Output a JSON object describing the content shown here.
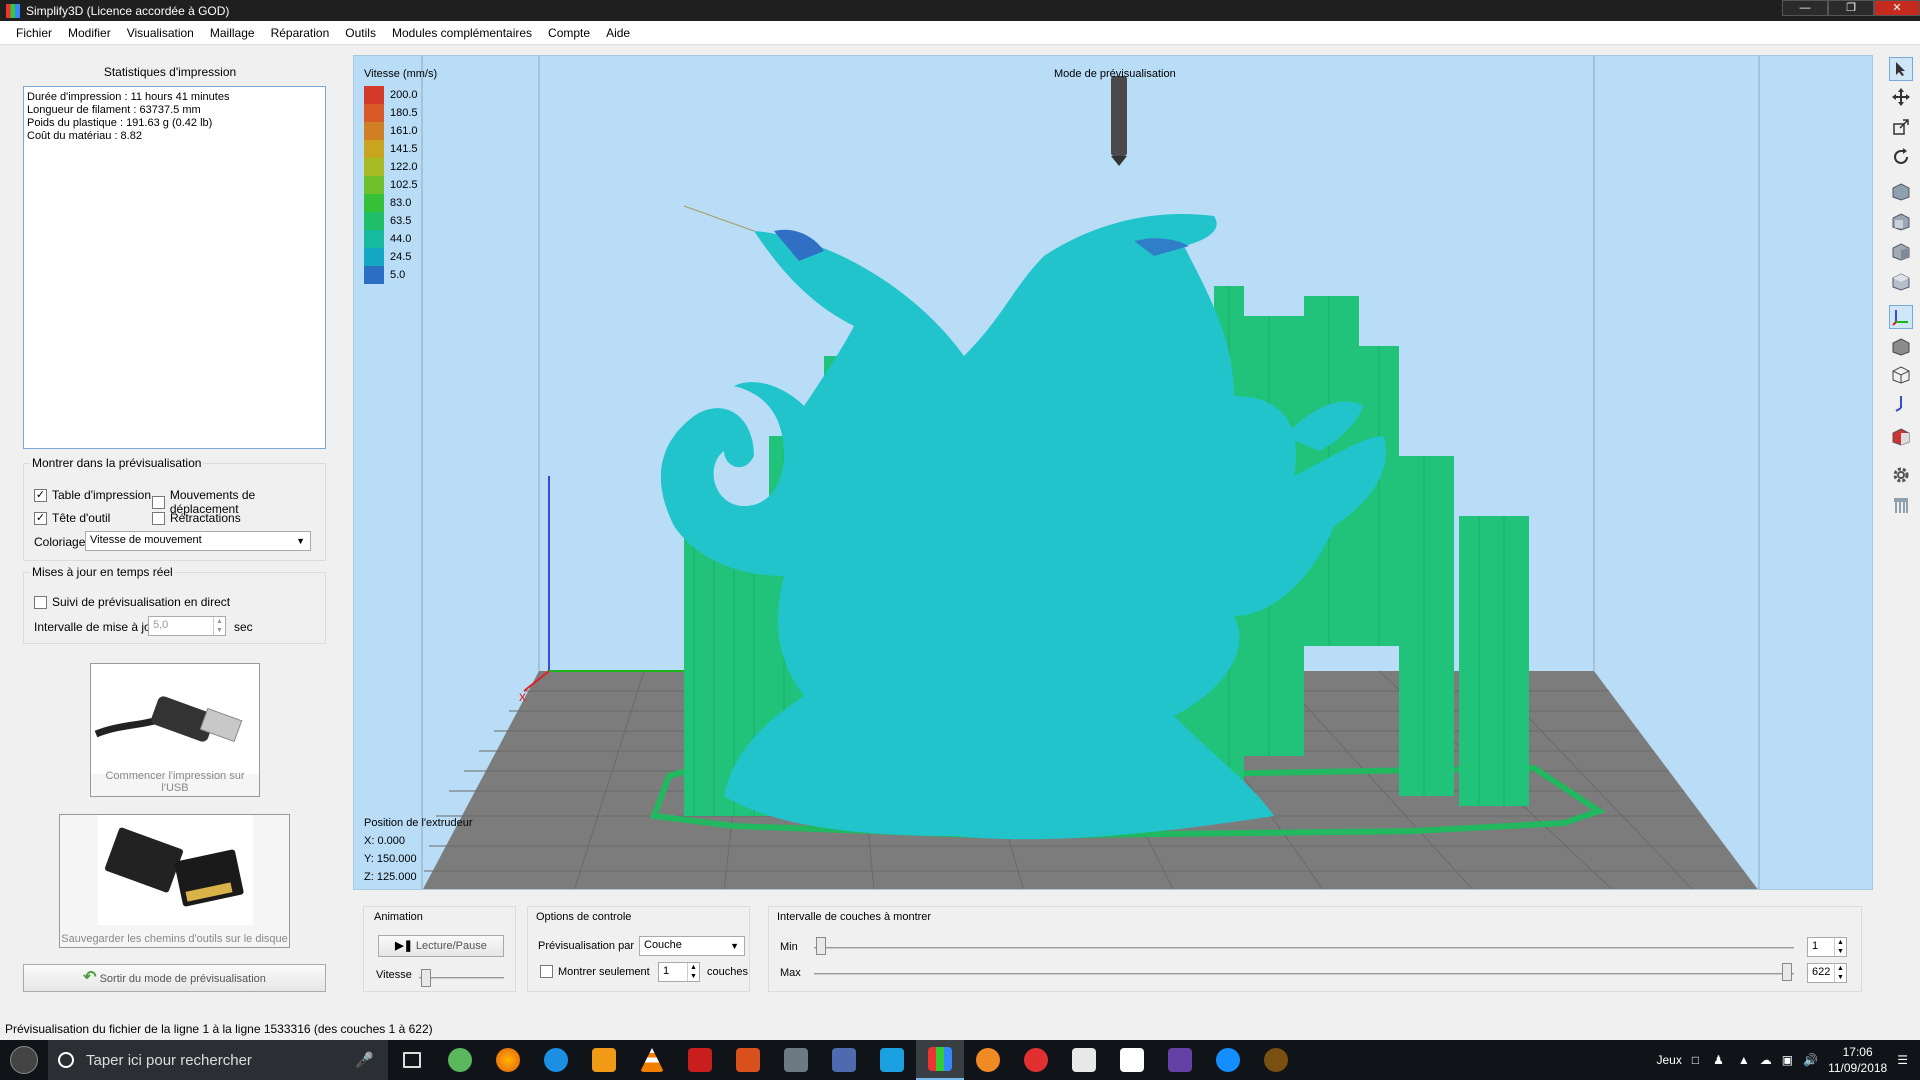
{
  "window": {
    "title": "Simplify3D (Licence accordée à GOD)"
  },
  "menu": [
    "Fichier",
    "Modifier",
    "Visualisation",
    "Maillage",
    "Réparation",
    "Outils",
    "Modules complémentaires",
    "Compte",
    "Aide"
  ],
  "stats": {
    "title": "Statistiques d'impression",
    "lines": [
      "Durée d'impression : 11 hours 41 minutes",
      "Longueur de filament : 63737.5 mm",
      "Poids du plastique : 191.63 g (0.42 lb)",
      "Coût du matériau : 8.82"
    ]
  },
  "preview_show": {
    "title": "Montrer dans la prévisualisation",
    "table": {
      "label": "Table d'impression",
      "checked": true
    },
    "travel": {
      "label": "Mouvements de déplacement",
      "checked": false
    },
    "tool_head": {
      "label": "Tête d'outil",
      "checked": true
    },
    "retractions": {
      "label": "Rétractations",
      "checked": false
    },
    "coloring_label": "Coloriage",
    "coloring_value": "Vitesse de mouvement"
  },
  "realtime": {
    "title": "Mises à jour en temps réel",
    "follow": {
      "label": "Suivi de prévisualisation en direct",
      "checked": false
    },
    "interval_label": "Intervalle de mise à jour",
    "interval_value": "5,0",
    "interval_unit": "sec"
  },
  "usb_button": {
    "label": "Commencer l'impression sur l'USB"
  },
  "sd_button": {
    "label": "Sauvegarder les chemins d'outils sur le disque"
  },
  "exit_button": {
    "label": "Sortir du mode de prévisualisation"
  },
  "viewport": {
    "legend_title": "Vitesse (mm/s)",
    "legend": [
      {
        "value": "200.0",
        "color": "#d43a2a"
      },
      {
        "value": "180.5",
        "color": "#d75a26"
      },
      {
        "value": "161.0",
        "color": "#d17f24"
      },
      {
        "value": "141.5",
        "color": "#c9a51f"
      },
      {
        "value": "122.0",
        "color": "#a7bb25"
      },
      {
        "value": "102.5",
        "color": "#6dbf2c"
      },
      {
        "value": "83.0",
        "color": "#34c039"
      },
      {
        "value": "63.5",
        "color": "#1fbf6a"
      },
      {
        "value": "44.0",
        "color": "#16bb9f"
      },
      {
        "value": "24.5",
        "color": "#15a8c3"
      },
      {
        "value": "5.0",
        "color": "#2b6fc5"
      }
    ],
    "mode_label": "Mode de prévisualisation",
    "extruder_title": "Position de l'extrudeur",
    "extruder_x": "X: 0.000",
    "extruder_y": "Y: 150.000",
    "extruder_z": "Z: 125.000"
  },
  "animation": {
    "title": "Animation",
    "play_label": "Lecture/Pause",
    "speed_label": "Vitesse"
  },
  "control": {
    "title": "Options de controle",
    "preview_by_label": "Prévisualisation par",
    "preview_by_value": "Couche",
    "show_only_label": "Montrer seulement",
    "show_only_value": "1",
    "show_only_unit": "couches"
  },
  "layers": {
    "title": "Intervalle de couches à montrer",
    "min_label": "Min",
    "min_value": "1",
    "max_label": "Max",
    "max_value": "622"
  },
  "status": "Prévisualisation du fichier de la ligne 1 à la ligne 1533316 (des couches 1 à 622)",
  "taskbar": {
    "search_placeholder": "Taper ici pour rechercher",
    "games_label": "Jeux",
    "time": "17:06",
    "date": "11/09/2018"
  }
}
